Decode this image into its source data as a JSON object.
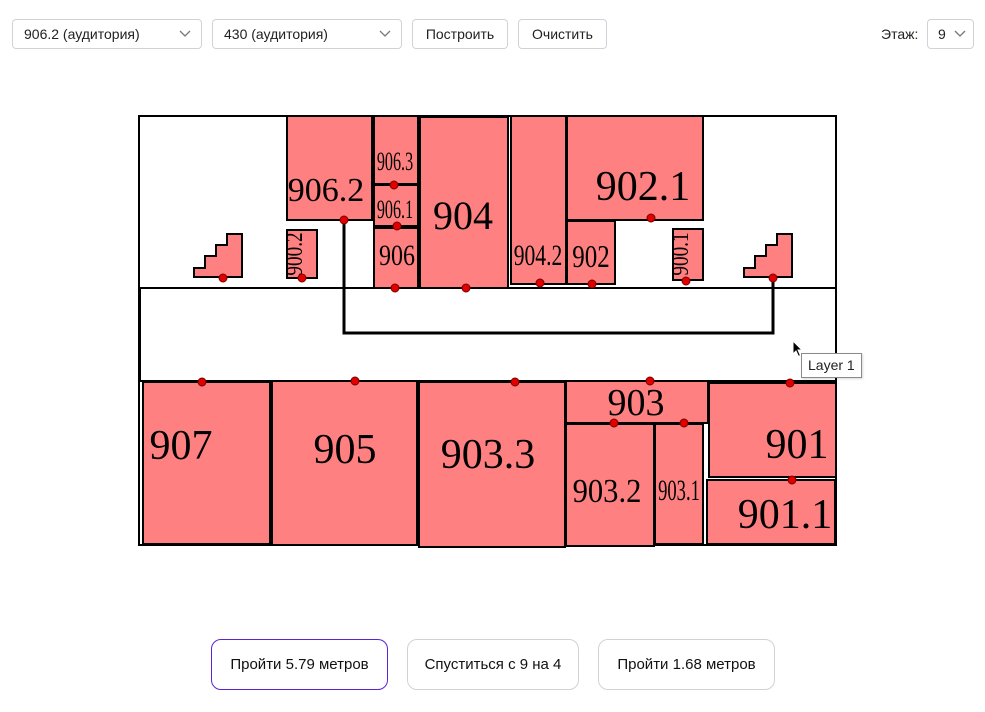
{
  "toolbar": {
    "from_select": {
      "value": "906.2 (аудитория)"
    },
    "to_select": {
      "value": "430 (аудитория)"
    },
    "build_label": "Построить",
    "clear_label": "Очистить",
    "floor_label": "Этаж:",
    "floor_select": {
      "value": "9"
    }
  },
  "map": {
    "layer_tooltip": "Layer 1",
    "rooms": {
      "r906_2": "906.2",
      "r906_3": "906.3",
      "r906_1": "906.1",
      "r904": "904",
      "r906": "906",
      "r904_2": "904.2",
      "r902_1": "902.1",
      "r902": "902",
      "r900_2": "900.2",
      "r900_1": "900.1",
      "r907": "907",
      "r905": "905",
      "r903_3": "903.3",
      "r903": "903",
      "r903_2": "903.2",
      "r903_1": "903.1",
      "r901": "901",
      "r901_1": "901.1"
    },
    "colors": {
      "room_fill": "#ff8080",
      "node": "#e00000",
      "wall": "#000000"
    }
  },
  "steps": [
    {
      "label": "Пройти 5.79 метров",
      "active": true
    },
    {
      "label": "Спуститься с 9 на 4",
      "active": false
    },
    {
      "label": "Пройти 1.68 метров",
      "active": false
    }
  ]
}
